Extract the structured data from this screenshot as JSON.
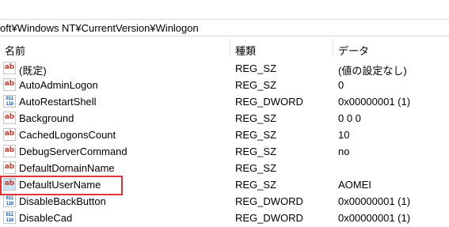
{
  "address": {
    "path": "oft¥Windows NT¥CurrentVersion¥Winlogon"
  },
  "columns": {
    "name": "名前",
    "type": "種類",
    "data": "データ"
  },
  "rows": [
    {
      "icon": "string-value-icon",
      "name": "(既定)",
      "type": "REG_SZ",
      "data": "(値の設定なし)"
    },
    {
      "icon": "string-value-icon",
      "name": "AutoAdminLogon",
      "type": "REG_SZ",
      "data": "0"
    },
    {
      "icon": "binary-value-icon",
      "name": "AutoRestartShell",
      "type": "REG_DWORD",
      "data": "0x00000001 (1)"
    },
    {
      "icon": "string-value-icon",
      "name": "Background",
      "type": "REG_SZ",
      "data": "0 0 0"
    },
    {
      "icon": "string-value-icon",
      "name": "CachedLogonsCount",
      "type": "REG_SZ",
      "data": "10"
    },
    {
      "icon": "string-value-icon",
      "name": "DebugServerCommand",
      "type": "REG_SZ",
      "data": "no"
    },
    {
      "icon": "string-value-icon",
      "name": "DefaultDomainName",
      "type": "REG_SZ",
      "data": ""
    },
    {
      "icon": "string-value-icon",
      "name": "DefaultUserName",
      "type": "REG_SZ",
      "data": "AOMEI"
    },
    {
      "icon": "binary-value-icon",
      "name": "DisableBackButton",
      "type": "REG_DWORD",
      "data": "0x00000001 (1)"
    },
    {
      "icon": "binary-value-icon",
      "name": "DisableCad",
      "type": "REG_DWORD",
      "data": "0x00000001 (1)"
    }
  ],
  "icons": {
    "string_glyph": "ab",
    "binary_glyph": "011\n110"
  },
  "colors": {
    "highlight_border": "#e0333a",
    "string_icon": "#c0392b",
    "binary_icon": "#1f5fbf"
  }
}
